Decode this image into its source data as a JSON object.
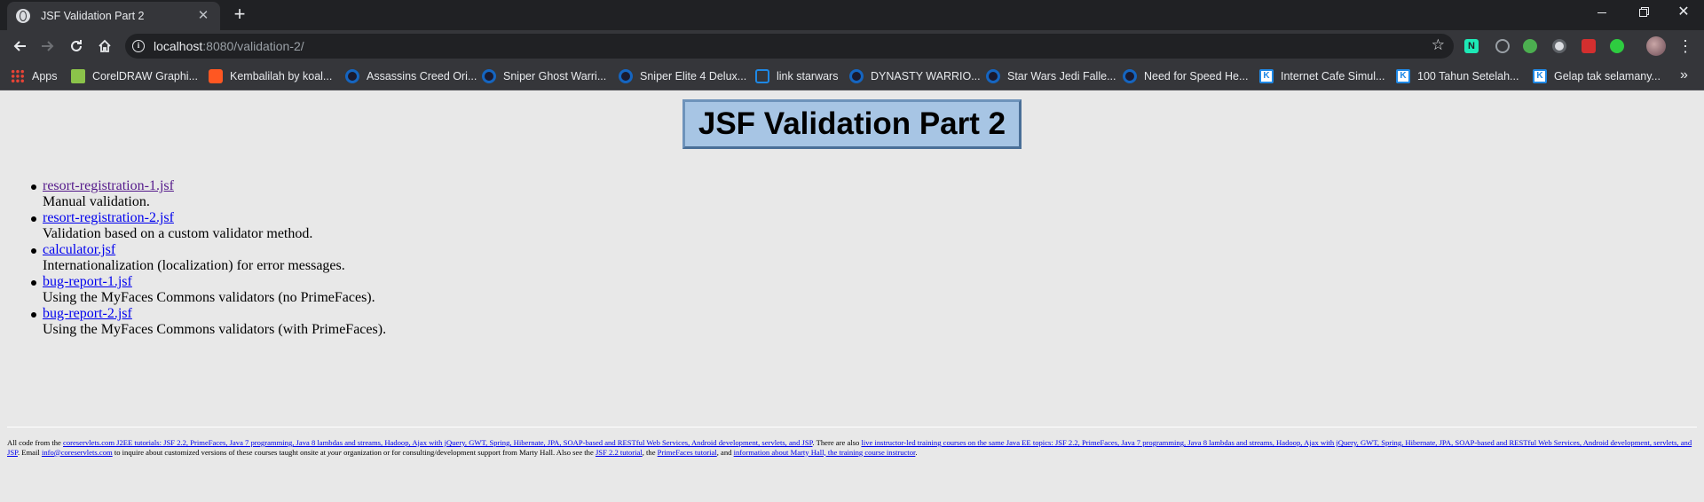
{
  "browser": {
    "tab_title": "JSF Validation Part 2",
    "url_host": "localhost",
    "url_rest": ":8080/validation-2/",
    "new_tab_symbol": "+",
    "tab_close_symbol": "✕",
    "window_close_symbol": "✕"
  },
  "bookmarks": [
    {
      "label": "Apps",
      "icon": "apps-grid-icon"
    },
    {
      "label": "CorelDRAW Graphi...",
      "icon": "coreldraw-icon"
    },
    {
      "label": "Kembalilah by koal...",
      "icon": "soundcloud-icon"
    },
    {
      "label": "Assassins Creed Ori...",
      "icon": "game-site-icon"
    },
    {
      "label": "Sniper Ghost Warri...",
      "icon": "game-site-icon"
    },
    {
      "label": "Sniper Elite 4 Delux...",
      "icon": "game-site-icon"
    },
    {
      "label": "link starwars",
      "icon": "link-icon"
    },
    {
      "label": "DYNASTY WARRIO...",
      "icon": "game-site-icon"
    },
    {
      "label": "Star Wars Jedi Falle...",
      "icon": "game-site-icon"
    },
    {
      "label": "Need for Speed He...",
      "icon": "game-site-icon"
    },
    {
      "label": "Internet Cafe Simul...",
      "icon": "k-site-icon"
    },
    {
      "label": "100 Tahun Setelah...",
      "icon": "k-site-icon"
    },
    {
      "label": "Gelap tak selamany...",
      "icon": "k-site-icon"
    }
  ],
  "page": {
    "title": "JSF Validation Part 2",
    "items": [
      {
        "link": "resort-registration-1.jsf",
        "desc": "Manual validation.",
        "visited": true
      },
      {
        "link": "resort-registration-2.jsf",
        "desc": "Validation based on a custom validator method.",
        "visited": false
      },
      {
        "link": "calculator.jsf",
        "desc": "Internationalization (localization) for error messages.",
        "visited": false
      },
      {
        "link": "bug-report-1.jsf",
        "desc": "Using the MyFaces Commons validators (no PrimeFaces).",
        "visited": false
      },
      {
        "link": "bug-report-2.jsf",
        "desc": "Using the MyFaces Commons validators (with PrimeFaces).",
        "visited": false
      }
    ],
    "footer": {
      "t1": "All code from the ",
      "l1": "coreservlets.com J2EE tutorials: JSF 2.2, PrimeFaces, Java 7 programming, Java 8 lambdas and streams, Hadoop, Ajax with jQuery, GWT, Spring, Hibernate, JPA, SOAP-based and RESTful Web Services, Android development, servlets, and JSP",
      "t2": ". There are also ",
      "l2": "live instructor-led training courses on the same Java EE topics: JSF 2.2, PrimeFaces, Java 7 programming, Java 8 lambdas and streams, Hadoop, Ajax with jQuery, GWT, Spring, Hibernate, JPA, SOAP-based and RESTful Web Services, Android development, servlets, and JSP",
      "t3": ". Email ",
      "l3": "info@coreservlets.com",
      "t4": " to inquire about customized versions of these courses taught onsite at ",
      "t4i": "your",
      "t5": " organization or for consulting/development support from Marty Hall. Also see the ",
      "l4": "JSF 2.2 tutorial",
      "t6": ", the ",
      "l5": "PrimeFaces tutorial",
      "t7": ", and ",
      "l6": "information about Marty Hall, the training course instructor",
      "t8": "."
    }
  }
}
